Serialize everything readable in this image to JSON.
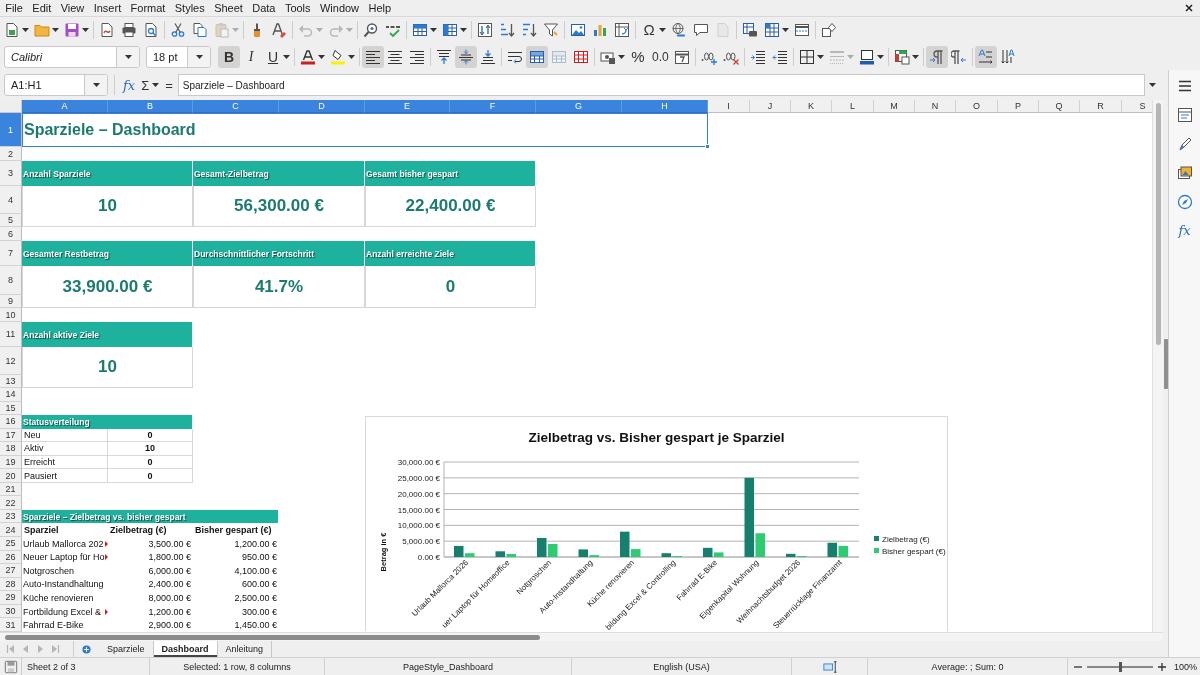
{
  "menu_bar": [
    "File",
    "Edit",
    "View",
    "Insert",
    "Format",
    "Styles",
    "Sheet",
    "Data",
    "Tools",
    "Window",
    "Help"
  ],
  "standard_toolbar": [
    {
      "disabled": false
    },
    {
      "disabled": false
    },
    {
      "disabled": false
    },
    {
      "disabled": false
    },
    {
      "disabled": false
    },
    {
      "disabled": false
    },
    {
      "disabled": false
    },
    {
      "disabled": false
    },
    {
      "disabled": true
    },
    {
      "disabled": false
    },
    {
      "disabled": false
    },
    {
      "disabled": true
    },
    {
      "disabled": true
    },
    {
      "disabled": false
    },
    {
      "disabled": false
    },
    {
      "disabled": false
    },
    {
      "disabled": false
    },
    {
      "disabled": false
    },
    {
      "disabled": false
    },
    {
      "disabled": false
    },
    {
      "disabled": false
    },
    {
      "disabled": false
    },
    {
      "disabled": false
    },
    {
      "disabled": false
    },
    {
      "label": "Ω",
      "disabled": false
    },
    {
      "disabled": false
    },
    {
      "disabled": false
    },
    {
      "disabled": true
    },
    {
      "disabled": false
    },
    {
      "disabled": false
    },
    {
      "disabled": false
    },
    {
      "disabled": false
    }
  ],
  "formatting_toolbar": {
    "font_name": "Calibri",
    "font_size": "18 pt",
    "buttons": [
      {
        "label": "B",
        "pressed": true,
        "disabled": false
      },
      {
        "label": "I",
        "pressed": false,
        "disabled": false
      },
      {
        "label": "U",
        "pressed": false,
        "disabled": false
      },
      {
        "pressed": false,
        "disabled": false
      },
      {
        "pressed": false,
        "disabled": false
      },
      {
        "pressed": true,
        "disabled": false
      },
      {
        "pressed": false,
        "disabled": false
      },
      {
        "pressed": false,
        "disabled": false
      },
      {
        "pressed": false,
        "disabled": false
      },
      {
        "pressed": true,
        "disabled": false
      },
      {
        "pressed": false,
        "disabled": false
      },
      {
        "pressed": false,
        "disabled": false
      },
      {
        "pressed": true,
        "disabled": false
      },
      {
        "pressed": false,
        "disabled": true
      },
      {
        "pressed": false,
        "disabled": false
      },
      {
        "pressed": false,
        "disabled": false
      },
      {
        "label": "%",
        "pressed": false,
        "disabled": false
      },
      {
        "label": "0.0",
        "pressed": false,
        "disabled": false
      },
      {
        "pressed": false,
        "disabled": false
      },
      {
        "pressed": false,
        "disabled": false
      },
      {
        "pressed": false,
        "disabled": false
      },
      {
        "pressed": false,
        "disabled": false
      },
      {
        "pressed": false,
        "disabled": false
      },
      {
        "pressed": false,
        "disabled": false
      },
      {
        "pressed": false,
        "disabled": true
      },
      {
        "pressed": false,
        "disabled": false
      },
      {
        "pressed": false,
        "disabled": false
      },
      {
        "pressed": true,
        "disabled": false
      },
      {
        "pressed": false,
        "disabled": false
      },
      {
        "pressed": true,
        "disabled": false
      },
      {
        "pressed": false,
        "disabled": false
      }
    ]
  },
  "formula_bar": {
    "name_box": "A1:H1",
    "function_wizard": "fx",
    "sum": "Σ",
    "equals": "=",
    "content": "Sparziele – Dashboard"
  },
  "sheet": {
    "columns": [
      {
        "label": "A",
        "selected": true
      },
      {
        "label": "B",
        "selected": true
      },
      {
        "label": "C",
        "selected": true
      },
      {
        "label": "D",
        "selected": true
      },
      {
        "label": "E",
        "selected": true
      },
      {
        "label": "F",
        "selected": true
      },
      {
        "label": "G",
        "selected": true
      },
      {
        "label": "H",
        "selected": true
      },
      {
        "label": "I",
        "selected": false
      },
      {
        "label": "J",
        "selected": false
      },
      {
        "label": "K",
        "selected": false
      },
      {
        "label": "L",
        "selected": false
      },
      {
        "label": "M",
        "selected": false
      },
      {
        "label": "N",
        "selected": false
      },
      {
        "label": "O",
        "selected": false
      },
      {
        "label": "P",
        "selected": false
      },
      {
        "label": "Q",
        "selected": false
      },
      {
        "label": "R",
        "selected": false
      },
      {
        "label": "S",
        "selected": false
      }
    ],
    "rows": [
      {
        "label": "1",
        "selected": true
      },
      {
        "label": "2",
        "selected": false
      },
      {
        "label": "3",
        "selected": false
      },
      {
        "label": "4",
        "selected": false
      },
      {
        "label": "5",
        "selected": false
      },
      {
        "label": "6",
        "selected": false
      },
      {
        "label": "7",
        "selected": false
      },
      {
        "label": "8",
        "selected": false
      },
      {
        "label": "9",
        "selected": false
      },
      {
        "label": "10",
        "selected": false
      },
      {
        "label": "11",
        "selected": false
      },
      {
        "label": "12",
        "selected": false
      },
      {
        "label": "13",
        "selected": false
      },
      {
        "label": "14",
        "selected": false
      },
      {
        "label": "15",
        "selected": false
      },
      {
        "label": "16",
        "selected": false
      },
      {
        "label": "17",
        "selected": false
      },
      {
        "label": "18",
        "selected": false
      },
      {
        "label": "19",
        "selected": false
      },
      {
        "label": "20",
        "selected": false
      },
      {
        "label": "21",
        "selected": false
      },
      {
        "label": "22",
        "selected": false
      },
      {
        "label": "23",
        "selected": false
      },
      {
        "label": "24",
        "selected": false
      },
      {
        "label": "25",
        "selected": false
      },
      {
        "label": "26",
        "selected": false
      },
      {
        "label": "27",
        "selected": false
      },
      {
        "label": "28",
        "selected": false
      },
      {
        "label": "29",
        "selected": false
      },
      {
        "label": "30",
        "selected": false
      },
      {
        "label": "31",
        "selected": false
      }
    ],
    "title": {
      "text": "Sparziele – Dashboard",
      "selected": true
    },
    "kpi_cards": [
      {
        "label": "Anzahl Sparziele",
        "value": "10"
      },
      {
        "label": "Gesamt-Zielbetrag",
        "value": "56,300.00 €"
      },
      {
        "label": "Gesamt bisher gespart",
        "value": "22,400.00 €"
      },
      {
        "label": "Gesamter Restbetrag",
        "value": "33,900.00 €"
      },
      {
        "label": "Durchschnittlicher Fortschritt",
        "value": "41.7%"
      },
      {
        "label": "Anzahl erreichte Ziele",
        "value": "0"
      },
      {
        "label": "Anzahl aktive Ziele",
        "value": "10"
      }
    ],
    "status_table": {
      "title": "Statusverteilung",
      "rows": [
        {
          "label": "Neu",
          "value": "0"
        },
        {
          "label": "Aktiv",
          "value": "10"
        },
        {
          "label": "Erreicht",
          "value": "0"
        },
        {
          "label": "Pausiert",
          "value": "0"
        }
      ]
    },
    "goals_table": {
      "title": "Sparziele – Zielbetrag vs. bisher gespart",
      "columns": [
        "Sparziel",
        "Zielbetrag (€)",
        "Bisher gespart (€)"
      ],
      "rows": [
        {
          "name": "Urlaub Mallorca 202",
          "truncated": true,
          "target": "3,500.00 €",
          "saved": "1,200.00 €"
        },
        {
          "name": "Neuer Laptop für Ho",
          "truncated": true,
          "target": "1,800.00 €",
          "saved": "950.00 €"
        },
        {
          "name": "Notgroschen",
          "truncated": false,
          "target": "6,000.00 €",
          "saved": "4,100.00 €"
        },
        {
          "name": "Auto-Instandhaltung",
          "truncated": false,
          "target": "2,400.00 €",
          "saved": "600.00 €"
        },
        {
          "name": "Küche renovieren",
          "truncated": false,
          "target": "8,000.00 €",
          "saved": "2,500.00 €"
        },
        {
          "name": "Fortbildung Excel &",
          "truncated": true,
          "target": "1,200.00 €",
          "saved": "300.00 €"
        },
        {
          "name": "Fahrrad E-Bike",
          "truncated": false,
          "target": "2,900.00 €",
          "saved": "1,450.00 €"
        }
      ]
    },
    "chart": {
      "chart_data": {
        "type": "bar",
        "title": "Zielbetrag vs. Bisher gespart je Sparziel",
        "ylabel": "Betrag in €",
        "categories": [
          "Urlaub Mallorca 2026",
          "uer Laptop für Homeoffice",
          "Notgroschen",
          "Auto-Instandhaltung",
          "Küche renovieren",
          "bildung Excel & Controlling",
          "Fahrrad E-Bike",
          "Eigenkapital Wohnung",
          "Weihnachtsbudget 2026",
          "Steuerrücklage Finanzamt"
        ],
        "series": [
          {
            "name": "Zielbetrag (€)",
            "color": "#16806e",
            "values": [
              3500,
              1800,
              6000,
              2400,
              8000,
              1200,
              2900,
              25000,
              1000,
              4500
            ]
          },
          {
            "name": "Bisher gespart (€)",
            "color": "#2ecc71",
            "values": [
              1200,
              950,
              4100,
              600,
              2500,
              300,
              1450,
              7500,
              300,
              3500
            ]
          }
        ],
        "ylim": [
          0,
          30000
        ],
        "yticks": [
          {
            "value": 0,
            "label": "0.00 €"
          },
          {
            "value": 5000,
            "label": "5,000.00 €"
          },
          {
            "value": 10000,
            "label": "10,000.00 €"
          },
          {
            "value": 15000,
            "label": "15,000.00 €"
          },
          {
            "value": 20000,
            "label": "20,000.00 €"
          },
          {
            "value": 25000,
            "label": "25,000.00 €"
          },
          {
            "value": 30000,
            "label": "30,000.00 €"
          }
        ],
        "grid": true,
        "legend": true
      }
    }
  },
  "sheet_tabs": {
    "navigation": [
      {
        "disabled": true
      },
      {
        "disabled": true
      },
      {
        "disabled": true
      },
      {
        "disabled": true
      }
    ],
    "tabs": [
      {
        "label": "Sparziele",
        "selected": false
      },
      {
        "label": "Dashboard",
        "selected": true
      },
      {
        "label": "Anleitung",
        "selected": false
      }
    ]
  },
  "sidebar": {
    "functions_label": "fx"
  },
  "status_bar": {
    "sheet": "Sheet 2 of 3",
    "selection": "Selected: 1 row, 8 columns",
    "page_style": "PageStyle_Dashboard",
    "language": "English (USA)",
    "summary": "Average: ; Sum: 0",
    "zoom": {
      "level": 0.5,
      "reading": "100%"
    }
  }
}
